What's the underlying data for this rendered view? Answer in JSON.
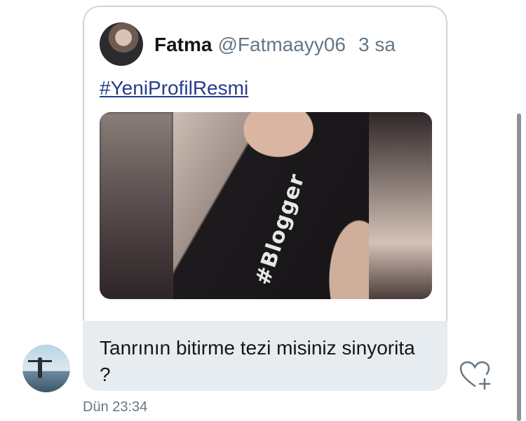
{
  "tweet": {
    "author_name": "Fatma",
    "author_handle": "@Fatmaayy06",
    "time_ago": "3 sa",
    "hashtag": "#YeniProfilResmi",
    "media_shirt_text": "#Blogger"
  },
  "message": {
    "text": "Tanrının bitirme tezi misiniz sinyorita ?",
    "timestamp": "Dün 23:34"
  },
  "icons": {
    "like": "heart-plus-icon"
  }
}
